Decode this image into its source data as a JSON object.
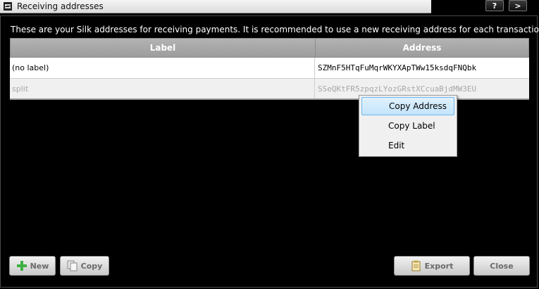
{
  "window": {
    "title": "Receiving addresses",
    "help_label": "?",
    "next_label": ">"
  },
  "description": "These are your Silk addresses for receiving payments. It is recommended to use a new receiving address for each transaction.",
  "table": {
    "columns": [
      "Label",
      "Address"
    ],
    "rows": [
      {
        "label": "(no label)",
        "address": "SZMnF5HTqFuMqrWKYXApTWw15ksdqFNQbk"
      },
      {
        "label": "split",
        "address": "SSeQKtFR5zpqzLYozGRstXCcuaBjdMW3EU"
      }
    ]
  },
  "context_menu": {
    "items": [
      "Copy Address",
      "Copy Label",
      "Edit"
    ],
    "highlighted": "Copy Address"
  },
  "buttons": {
    "new": "New",
    "copy": "Copy",
    "export": "Export",
    "close": "Close"
  },
  "icons": {
    "app": "app-icon",
    "new": "plus-icon",
    "copy": "copy-icon",
    "export": "export-icon"
  },
  "colors": {
    "background": "#000000",
    "header": "#a8a8a8",
    "menu_highlight": "#c4e4fb",
    "new_icon": "#3cb043"
  }
}
